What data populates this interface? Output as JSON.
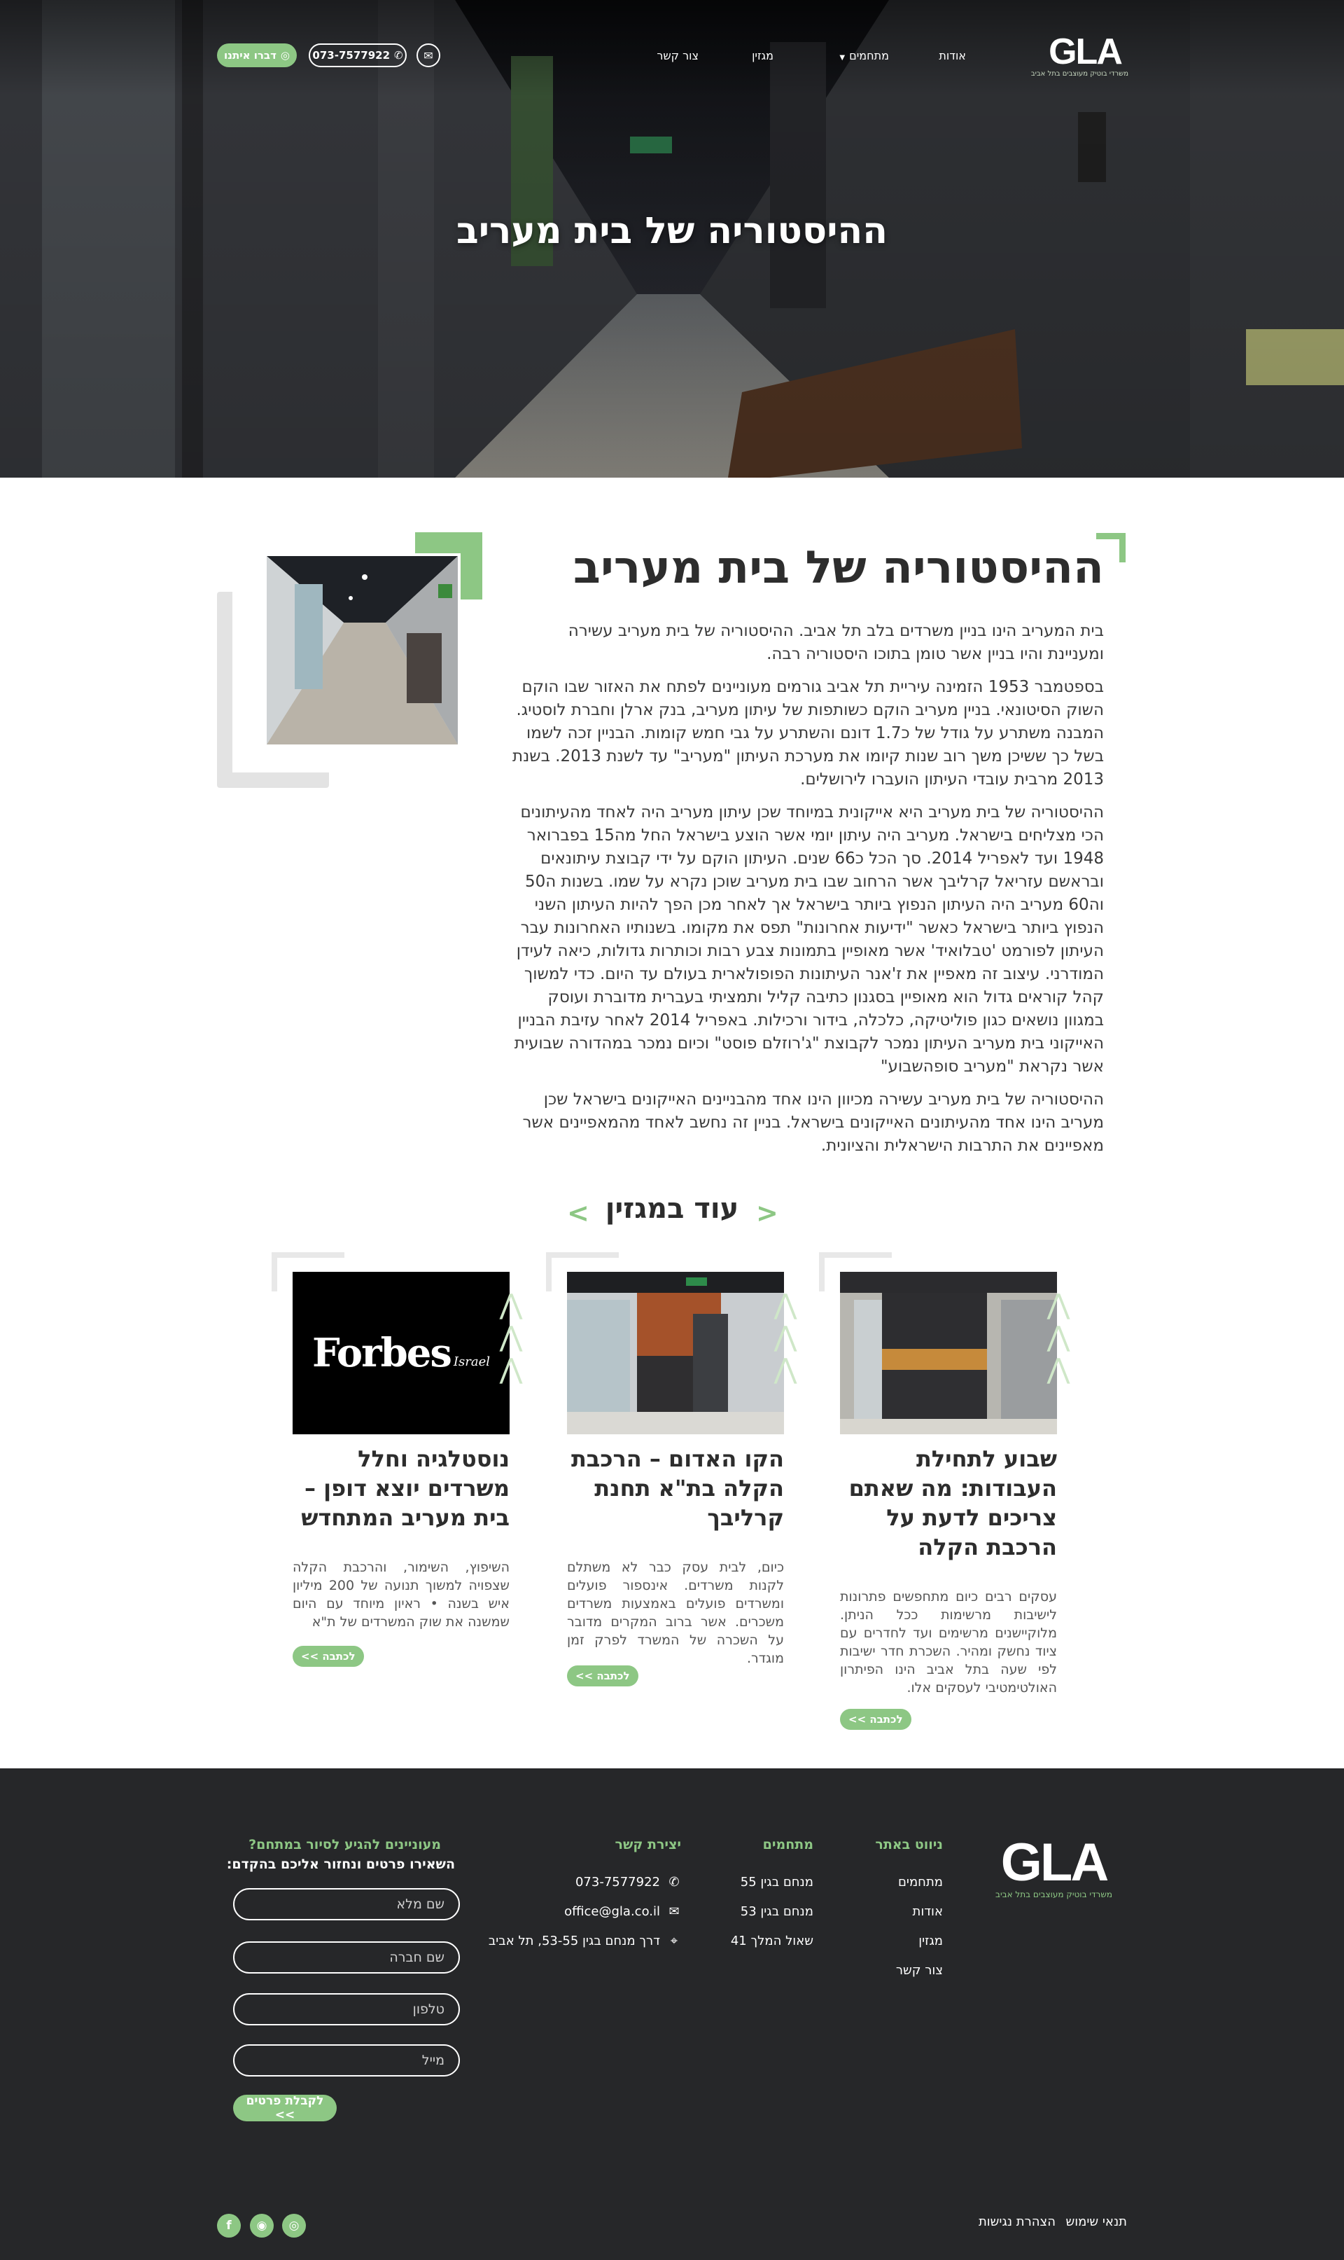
{
  "header": {
    "logo_text": "GLA",
    "logo_tagline": "משרדי בוטיק מעוצבים בתל אביב",
    "nav": [
      "אודות",
      "מתחמים",
      "מגזין",
      "צור קשר"
    ],
    "mail_icon": "mail-icon",
    "phone": "073-7577922",
    "whatsapp_label": "דברו איתנו"
  },
  "hero": {
    "title": "ההיסטוריה של בית מעריב"
  },
  "article": {
    "title": "ההיסטוריה של בית מעריב",
    "paragraphs": [
      "בית המעריב הינו בניין משרדים בלב תל אביב. ההיסטוריה של בית מעריב עשירה ומעניינת והיו בניין אשר טומן בתוכו היסטוריה רבה.",
      "בספטמבר 1953 הזמינה עיריית תל אביב גורמים מעוניינים לפתח את האזור שבו הוקם השוק הסיטונאי. בניין מעריב הוקם כשותפות של עיתון מעריב, בנק ארלן וחברת לוסטיג. המבנה משתרע על גודל של כ1.7 דונם והשתרע על גבי חמש קומות. הבניין זכה לשמו בשל כך ששיכן משך רוב שנות קיומו את מערכת העיתון \"מעריב\" עד לשנת 2013. בשנת 2013 מרבית עובדי העיתון הועברו לירושלים.",
      "ההיסטוריה של בית מעריב היא אייקונית במיוחד שכן עיתון מעריב היה לאחד מהעיתונים הכי מצליחים בישראל. מעריב היה עיתון יומי אשר הוצע בישראל החל מה15 בפברואר 1948 ועד לאפריל 2014. סך הכל כ66 שנים. העיתון הוקם על ידי קבוצת עיתונאים ובראשם עזריאל קרליבך אשר הרחוב שבו בית מעריב שוכן נקרא על שמו. בשנות ה50 וה60 מעריב היה העיתון הנפוץ ביותר בישראל אך לאחר מכן הפך להיות העיתון השני הנפוץ ביותר בישראל כאשר \"ידיעות אחרונות\" תפס את מקומו. בשנותיו האחרונות עבר העיתון לפורמט 'טבלואיד' אשר מאופיין בתמונות צבע רבות וכותרות גדולות, כיאה לעידן המודרני. עיצוב זה מאפיין את ז'אנר העיתונות הפופולארית בעולם עד היום. כדי למשוך קהל קוראים גדול הוא מאופיין בסגנון כתיבה קליל ותמציתי בעברית מדוברת ועוסק במגוון נושאים כגון פוליטיקה, כלכלה, בידור ורכילות. באפריל 2014 לאחר עזיבת הבניין האייקוני בית מעריב העיתון נמכר לקבוצת \"ג'רוזלם פוסט\" וכיום נמכר במהדורה שבועית אשר נקראת \"מעריב סופהשבוע\"",
      "ההיסטוריה של בית מעריב עשירה מכיוון הינו אחד מהבניינים האייקונים בישראל שכן מעריב הינו אחד מהעיתונים האייקונים בישראל. בניין זה נחשב לאחד מהמאפיינים אשר מאפיינים את התרבות הישראלית והציונית."
    ]
  },
  "more": {
    "title": "עוד במגזין",
    "read_more": "לכתבה >>",
    "cards": [
      {
        "title": "שבוע לתחילת העבודות: מה שאתם צריכים לדעת על הרכבת הקלה",
        "excerpt": "עסקים רבים כיום מתחפשים פתרונות לישיבות מרשימות ככל הניתן. מלוקיישנים מרשימים ועד לחדרים עם ציוד נחשק ומהיר. השכרת חדר ישיבות לפי שעה בתל אביב הינו הפיתרון האולטימטיבי לעסקים אלו."
      },
      {
        "title": "הקו האדום – הרכבת הקלה בת\"א תחנת קרליבך",
        "excerpt": "כיום, לבית עסק כבר לא משתלם לקנות משרדים. אינספור פועלים ומשרדים פועלים באמצעות משרדים משכרים. אשר ברוב המקרים מדובר על השכרה של המשרד לפרק זמן מוגדר."
      },
      {
        "title": "נוסטלגיה וחלל משרדים יוצא דופן – בית מעריב המתחדש",
        "excerpt": "השיפוץ, השימור, והרכבת הקלה שצפויה למשוך תנועה של 200 מיליון איש בשנה • ראיון מיוחד עם היום שמשנה את שוק המשרדים של ת\"א",
        "image_brand": "Forbes",
        "image_brand_sub": "Israel"
      }
    ]
  },
  "footer": {
    "logo_text": "GLA",
    "logo_tagline": "משרדי בוטיק מעוצבים בתל אביב",
    "nav_title": "ניווט באתר",
    "nav_items": [
      "מתחמים",
      "אודות",
      "מגזין",
      "צור קשר"
    ],
    "complexes_title": "מתחמים",
    "complexes": [
      "מנחם בגין 55",
      "מנחם בגין 53",
      "שאול המלך 41"
    ],
    "contact_title": "יצירת קשר",
    "phone": "073-7577922",
    "email": "office@gla.co.il",
    "address": "דרך מנחם בגין 53-55, תל אביב",
    "form_title_1": "מעוניינים להגיע לסיור במתחם?",
    "form_title_2": "השאירו פרטים ונחזור אליכם בהקדם:",
    "form_placeholders": {
      "name": "שם מלא",
      "company": "שם חברה",
      "phone": "טלפון",
      "email": "מייל"
    },
    "submit": "לקבלת פרטים >>",
    "legal": [
      "תנאי שימוש",
      "הצהרת נגישות"
    ],
    "social": [
      "whatsapp-icon",
      "instagram-icon",
      "facebook-icon"
    ]
  },
  "colors": {
    "accent": "#8dc784",
    "footer_bg": "#262729",
    "text": "#2d2d2d"
  }
}
